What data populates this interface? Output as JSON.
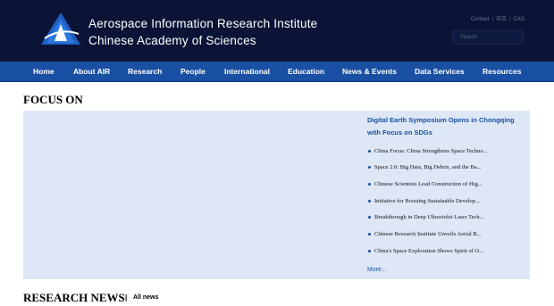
{
  "header": {
    "institute_line1": "Aerospace Information Research Institute",
    "institute_line2": "Chinese Academy of Sciences",
    "toplinks": [
      "Contact",
      "中文",
      "CAS"
    ],
    "search_placeholder": "Search"
  },
  "nav": [
    {
      "label": "Home"
    },
    {
      "label": "About AIR"
    },
    {
      "label": "Research"
    },
    {
      "label": "People"
    },
    {
      "label": "International"
    },
    {
      "label": "Education"
    },
    {
      "label": "News & Events"
    },
    {
      "label": "Data Services"
    },
    {
      "label": "Resources"
    }
  ],
  "focus": {
    "title": "FOCUS ON",
    "headline": "Digital Earth Symposium Opens in Chongqing with Focus on SDGs",
    "items": [
      "China Focus: China Strengthens Space Techno...",
      "Space 2.0: Big Data, Big Debris, and the Ba...",
      "Chinese Scientists Lead Construction of Hig...",
      "Initiative for Boosting Sustainable Develop...",
      "Breakthrough in Deep Ultraviolet Laser Tech...",
      "Chinese Research Institute Unveils Aerial B...",
      "China's Space Exploration Shows Spirit of O..."
    ],
    "more": "More..."
  },
  "research": {
    "title": "RESEARCH NEWS",
    "separator": "|",
    "all_news": "All news"
  },
  "colors": {
    "header_bg": "#0b1436",
    "nav_bg": "#1a50a3",
    "panel_bg": "#dde7f6",
    "link": "#1a4fa0"
  }
}
